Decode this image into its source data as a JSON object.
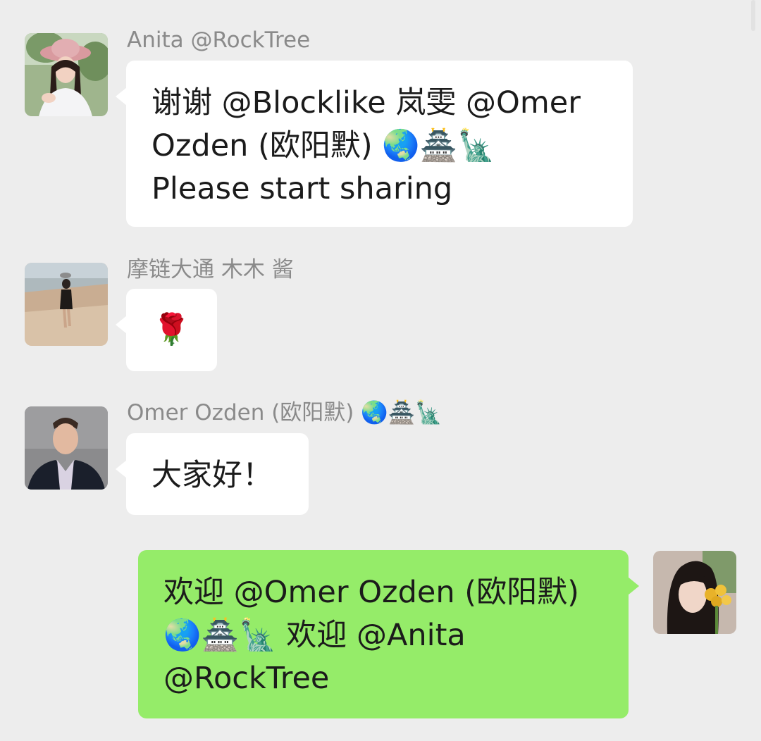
{
  "messages": [
    {
      "sender": "Anita @RockTree",
      "lines": [
        "谢谢 @Blocklike 岚雯 @Omer",
        "Ozden (欧阳默) 🌏🏯🗽",
        "Please start sharing"
      ]
    },
    {
      "sender": "摩链大通 木木 酱",
      "lines": [
        "🌹"
      ]
    },
    {
      "sender": "Omer Ozden (欧阳默) 🌏🏯🗽",
      "lines": [
        "大家好！"
      ]
    },
    {
      "sender": "",
      "lines": [
        "欢迎 @Omer Ozden (欧阳默)",
        "🌏🏯🗽 欢迎 @Anita",
        "@RockTree"
      ]
    }
  ],
  "colors": {
    "background": "#ededed",
    "incoming_bubble": "#ffffff",
    "outgoing_bubble": "#95ec69",
    "sender_name": "#8a8a8a"
  },
  "icons": [
    "avatar-photo-woman-hat",
    "avatar-photo-woman-beach",
    "avatar-photo-man-suit",
    "avatar-photo-woman-flowers"
  ]
}
